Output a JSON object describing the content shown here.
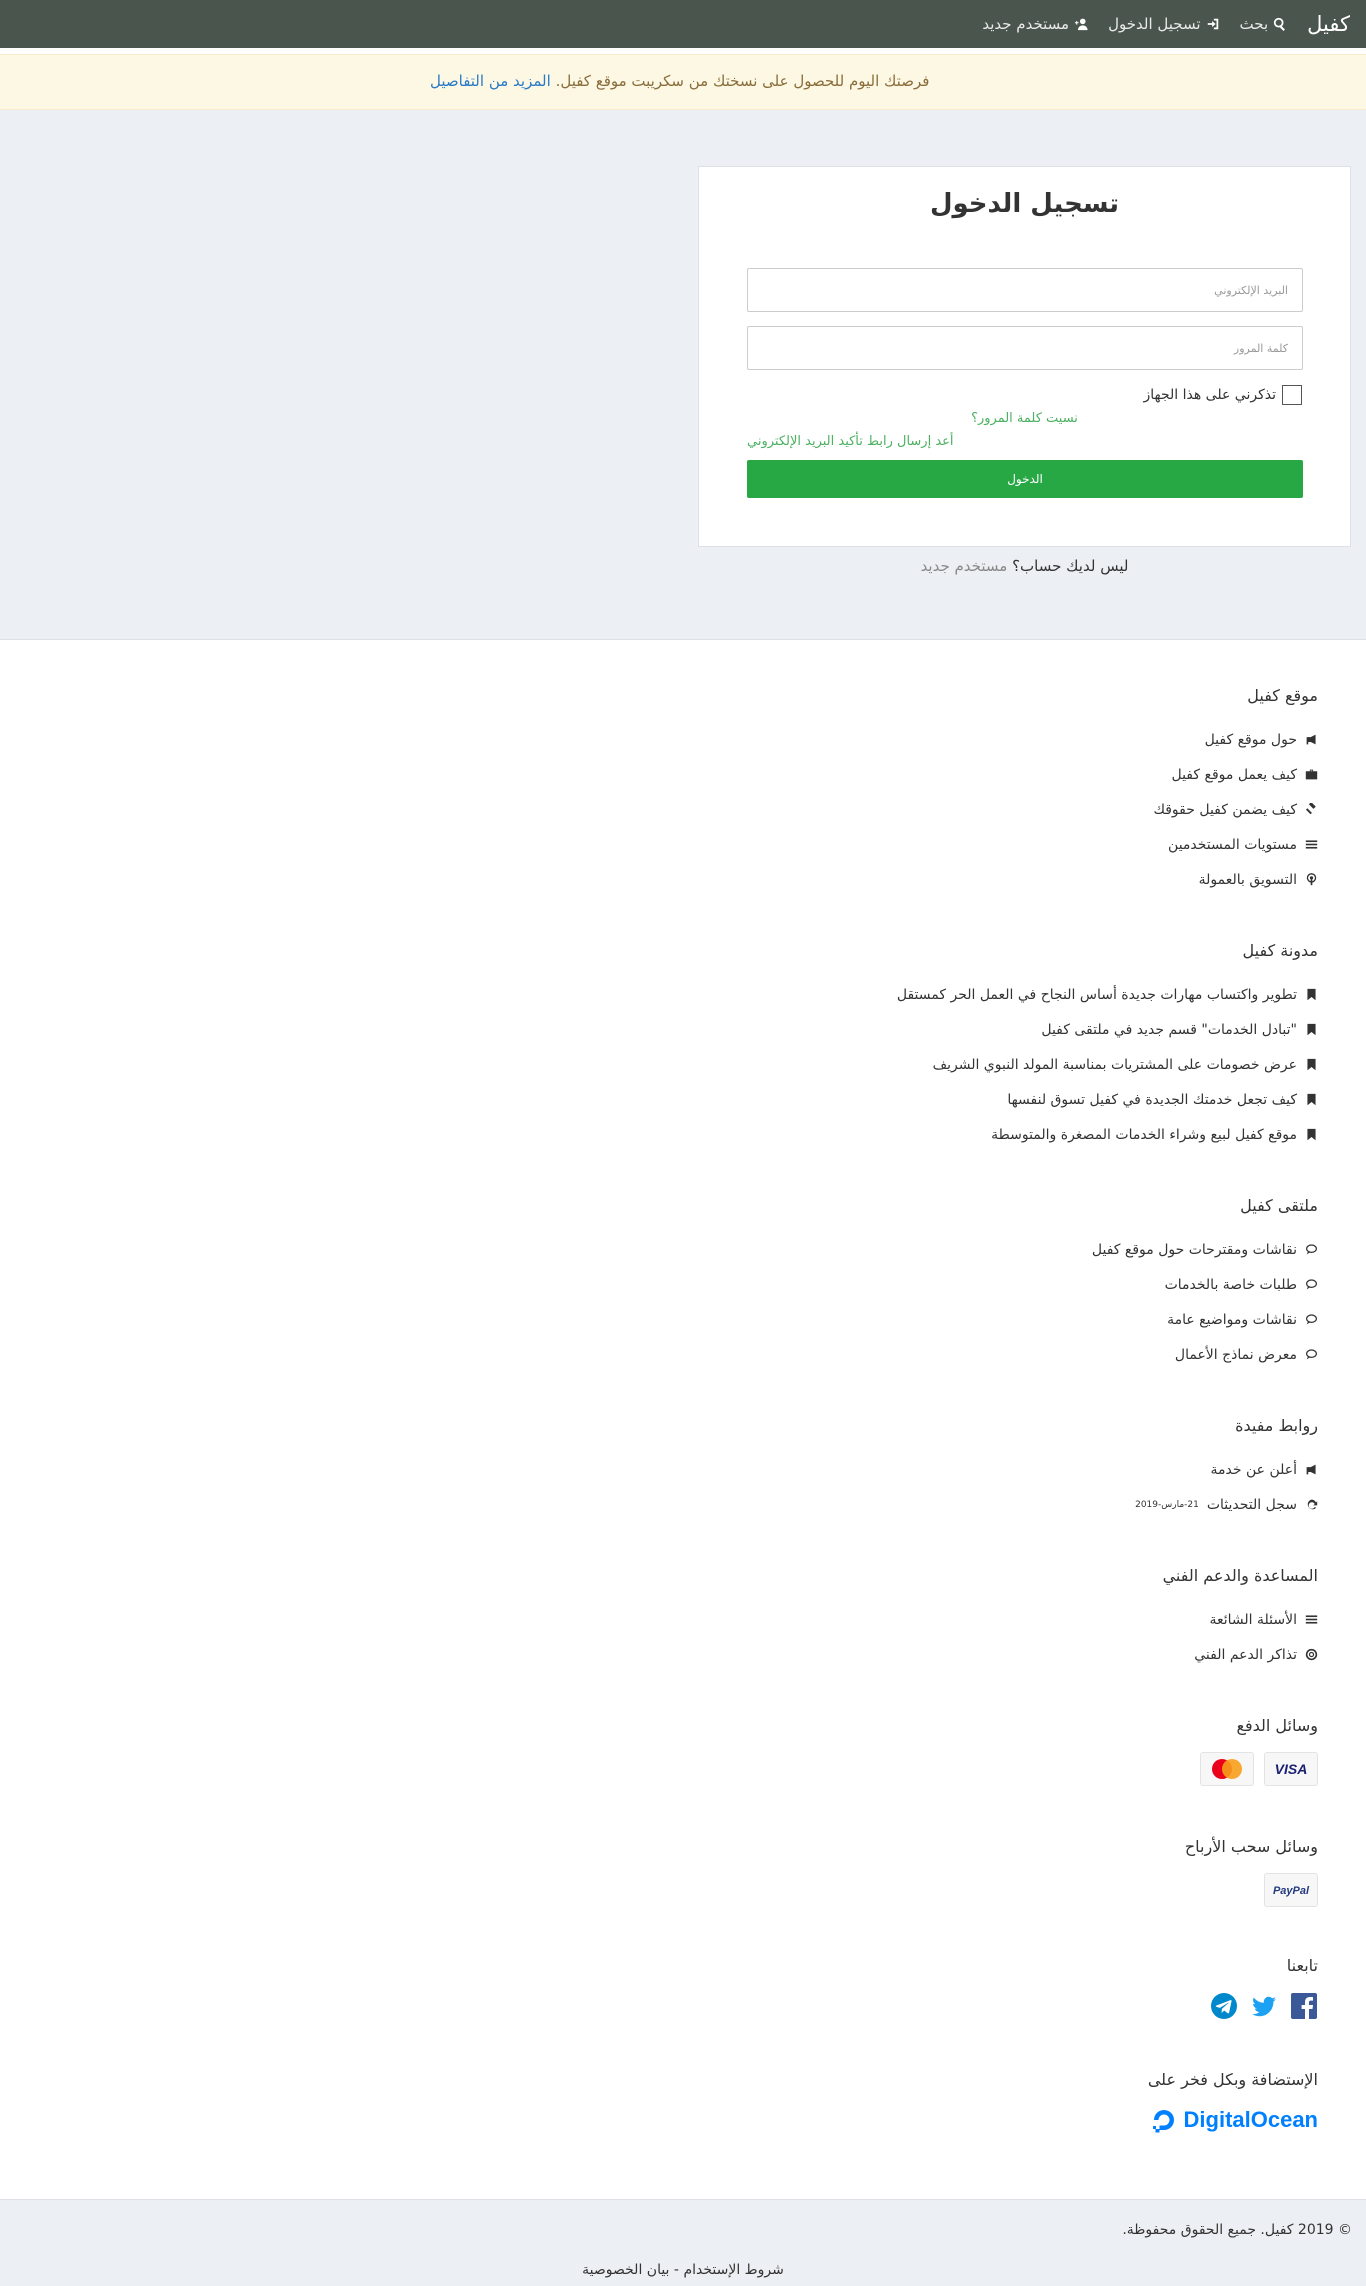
{
  "navbar": {
    "brand": "كفيل",
    "search_label": "بحث",
    "login_label": "تسجيل الدخول",
    "register_label": "مستخدم جديد"
  },
  "banner": {
    "text": "فرصتك اليوم للحصول على نسختك من سكريبت موقع كفيل.",
    "link": "المزيد من التفاصيل"
  },
  "login": {
    "title": "تسجيل الدخول",
    "email_placeholder": "البريد الإلكتروني",
    "password_placeholder": "كلمة المرور",
    "remember_label": "تذكرني على هذا الجهاز",
    "forgot_label": "نسيت كلمة المرور؟",
    "resend_label": "أعد إرسال رابط تأكيد البريد الإلكتروني",
    "submit_label": "الدخول",
    "no_account_text": "ليس لديك حساب؟",
    "signup_link": "مستخدم جديد"
  },
  "footer": {
    "site": {
      "title": "موقع كفيل",
      "items": [
        {
          "label": "حول موقع كفيل",
          "icon": "bullhorn-icon"
        },
        {
          "label": "كيف يعمل موقع كفيل",
          "icon": "briefcase-icon"
        },
        {
          "label": "كيف يضمن كفيل حقوقك",
          "icon": "gavel-icon"
        },
        {
          "label": "مستويات المستخدمين",
          "icon": "list-icon"
        },
        {
          "label": "التسويق بالعمولة",
          "icon": "podcast-icon"
        }
      ]
    },
    "blog": {
      "title": "مدونة كفيل",
      "items": [
        {
          "label": "تطوير واكتساب مهارات جديدة أساس النجاح في العمل الحر كمستقل",
          "icon": "bookmark-icon"
        },
        {
          "label": "\"تبادل الخدمات\" قسم جديد في ملتقى كفيل",
          "icon": "bookmark-icon"
        },
        {
          "label": "عرض خصومات على المشتريات بمناسبة المولد النبوي الشريف",
          "icon": "bookmark-icon"
        },
        {
          "label": "كيف تجعل خدمتك الجديدة في كفيل تسوق لنفسها",
          "icon": "bookmark-icon"
        },
        {
          "label": "موقع كفيل لبيع وشراء الخدمات المصغرة والمتوسطة",
          "icon": "bookmark-icon"
        }
      ]
    },
    "forum": {
      "title": "ملتقى كفيل",
      "items": [
        {
          "label": "نقاشات ومقترحات حول موقع كفيل",
          "icon": "comments-icon"
        },
        {
          "label": "طلبات خاصة بالخدمات",
          "icon": "comments-icon"
        },
        {
          "label": "نقاشات ومواضيع عامة",
          "icon": "comments-icon"
        },
        {
          "label": "معرض نماذج الأعمال",
          "icon": "comments-icon"
        }
      ]
    },
    "links": {
      "title": "روابط مفيدة",
      "advertise_label": "أعلن عن خدمة",
      "changelog_label": "سجل التحديثات",
      "changelog_date": "21-مارس-2019"
    },
    "support": {
      "title": "المساعدة والدعم الفني",
      "faq_label": "الأسئلة الشائعة",
      "tickets_label": "تذاكر الدعم الفني"
    },
    "payment": {
      "title": "وسائل الدفع",
      "methods": [
        "MasterCard",
        "VISA"
      ]
    },
    "withdraw": {
      "title": "وسائل سحب الأرباح",
      "methods": [
        "PayPal"
      ]
    },
    "follow": {
      "title": "تابعنا"
    },
    "hosting": {
      "title": "الإستضافة وبكل فخر على",
      "provider": "DigitalOcean"
    }
  },
  "bottom": {
    "copyright": "© 2019 كفيل. جميع الحقوق محفوظة.",
    "terms": "شروط الإستخدام",
    "separator": "-",
    "privacy": "بيان الخصوصية"
  },
  "colors": {
    "navbar": "#4a554e",
    "accent_green": "#28a745",
    "link_green": "#4cb061",
    "banner_bg": "#fcf8e3",
    "link_blue": "#2a7ac7"
  }
}
